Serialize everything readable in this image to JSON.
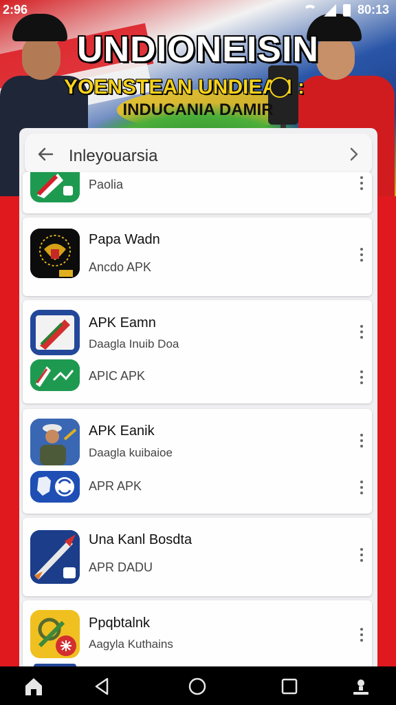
{
  "status_bar": {
    "time": "2:96",
    "clock_right": "80:13",
    "icons": [
      "wifi-icon",
      "signal-icon",
      "battery-icon"
    ]
  },
  "banner": {
    "title": "UNDIONEISIN",
    "subtitle": "YOENSTEAN UNDIEAN :",
    "tagline": "INDUCANIA DAMIR"
  },
  "search": {
    "value": "Inleyouarsia",
    "back_icon": "arrow-left-icon",
    "forward_icon": "chevron-right-icon"
  },
  "apps": [
    {
      "title": "",
      "subtitle": "Paolia"
    },
    {
      "title": "Papa Wadn",
      "subtitle": "Ancdo APK"
    },
    {
      "title": "APK Eamn",
      "subtitle": "Daagla Inuib Doa"
    },
    {
      "title": "",
      "subtitle": "APIC APK"
    },
    {
      "title": "APK Eanik",
      "subtitle": "Daagla kuibaioe"
    },
    {
      "title": "",
      "subtitle": "APR APK"
    },
    {
      "title": "Una Kanl Bosdta",
      "subtitle": "APR DADU"
    },
    {
      "title": "Ppqbtalnk",
      "subtitle": "Aagyla Kuthains"
    }
  ],
  "navbar": {
    "icons": [
      "home-icon",
      "back-icon",
      "circle-home-icon",
      "recents-icon",
      "profile-icon"
    ]
  },
  "colors": {
    "background_red": "#e0191f",
    "panel": "#f0f0f2",
    "card": "#fefefe"
  }
}
